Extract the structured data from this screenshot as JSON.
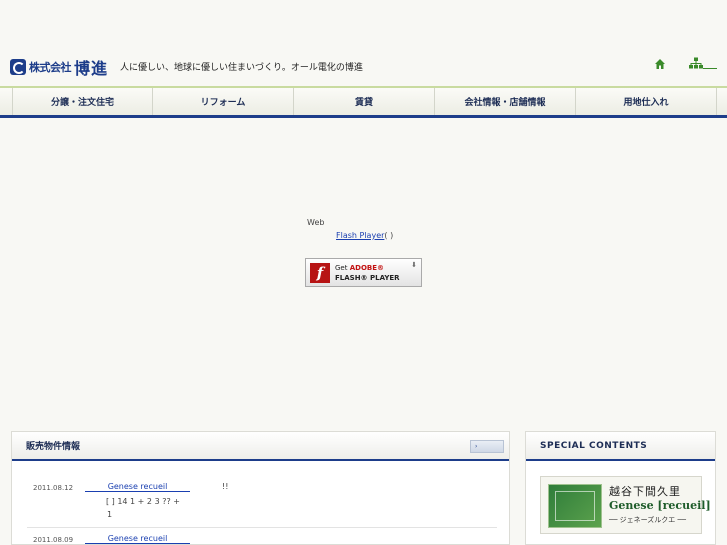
{
  "header": {
    "logo_kk": "株式会社",
    "logo_name": "博進",
    "tagline": "人に優しい、地球に優しい住まいづくり。オール電化の博進",
    "home_icon": "home-icon",
    "sitemap_icon": "sitemap-icon"
  },
  "nav": {
    "items": [
      {
        "label": "分譲・注文住宅"
      },
      {
        "label": "リフォーム"
      },
      {
        "label": "賃貸"
      },
      {
        "label": "会社情報・店舗情報"
      },
      {
        "label": "用地仕入れ"
      }
    ]
  },
  "flash": {
    "line1": "Web",
    "link": "Flash Player",
    "link_suffix": "(  )",
    "badge_get": "Get",
    "badge_adobe": "ADOBE®",
    "badge_player": "FLASH® PLAYER",
    "badge_arrow": "⬇"
  },
  "news": {
    "title": "販売物件情報",
    "more_label": "›",
    "items": [
      {
        "date": "2011.08.12",
        "link": "Genese recueil",
        "excl": "!!",
        "line2": "[    ]         14                                             1    +          2     3   ??                                  +",
        "line3": "1"
      },
      {
        "date": "2011.08.09",
        "link": "Genese recueil"
      }
    ]
  },
  "special": {
    "title": "SPECIAL CONTENTS",
    "banner": {
      "place": "越谷下間久里",
      "brand": "Genese [recueil]",
      "sub": "── ジェネーズルクエ ──"
    }
  },
  "colors": {
    "accent": "#1d3d8a",
    "link": "#1a3fb0",
    "nav_top": "#c9dba0",
    "flash_red": "#b71414",
    "banner_green": "#2f7d3a"
  }
}
